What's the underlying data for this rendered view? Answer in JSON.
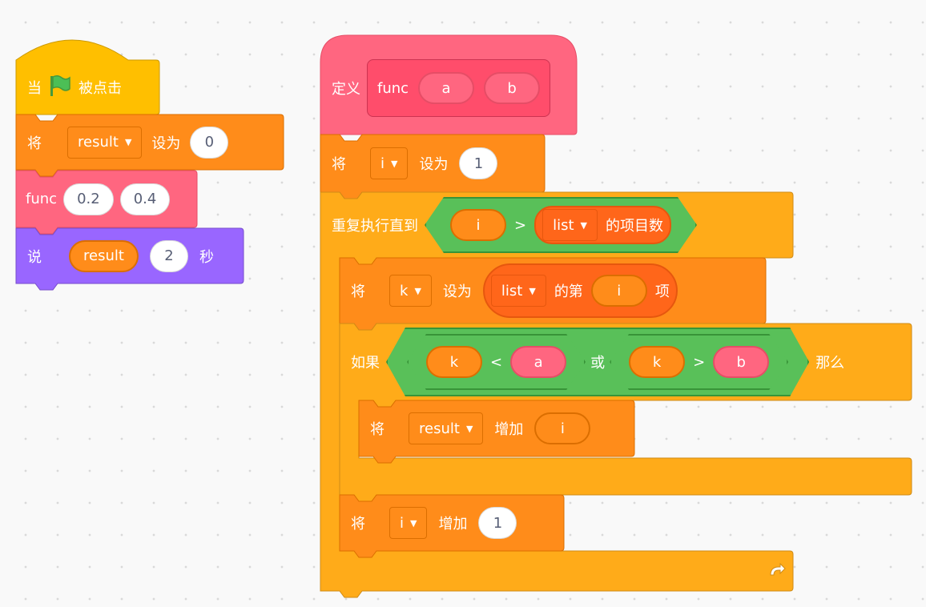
{
  "hat": {
    "when": "当",
    "clicked": "被点击"
  },
  "set_result": {
    "verb": "将",
    "var": "result",
    "set_to": "设为",
    "value": "0"
  },
  "call_func": {
    "name": "func",
    "arg1": "0.2",
    "arg2": "0.4"
  },
  "say": {
    "verb": "说",
    "reporter": "result",
    "secs": "2",
    "unit": "秒"
  },
  "define": {
    "label": "定义",
    "name": "func",
    "param_a": "a",
    "param_b": "b"
  },
  "set_i": {
    "verb": "将",
    "var": "i",
    "set_to": "设为",
    "value": "1"
  },
  "repeat_until": {
    "label": "重复执行直到",
    "left": "i",
    "op": ">",
    "list": "list",
    "length": "的项目数"
  },
  "set_k": {
    "verb": "将",
    "var": "k",
    "set_to": "设为",
    "list": "list",
    "item_of": "的第",
    "index": "i",
    "item_suffix": "项"
  },
  "if_block": {
    "label": "如果",
    "l1": "k",
    "op1": "<",
    "r1": "a",
    "or": "或",
    "l2": "k",
    "op2": ">",
    "r2": "b",
    "then": "那么"
  },
  "change_result": {
    "verb": "将",
    "var": "result",
    "change_by": "增加",
    "value": "i"
  },
  "change_i": {
    "verb": "将",
    "var": "i",
    "change_by": "增加",
    "value": "1"
  },
  "colors": {
    "events": "#ffbf00",
    "variables": "#ff8c1a",
    "control": "#ffab19",
    "myblocks": "#ff6680",
    "looks": "#9966ff",
    "operators": "#59c059",
    "lists": "#ff661a"
  },
  "icons": {
    "flag": "green-flag-icon",
    "loop": "loop-arrow-icon",
    "dropdown": "dropdown-caret-icon"
  }
}
